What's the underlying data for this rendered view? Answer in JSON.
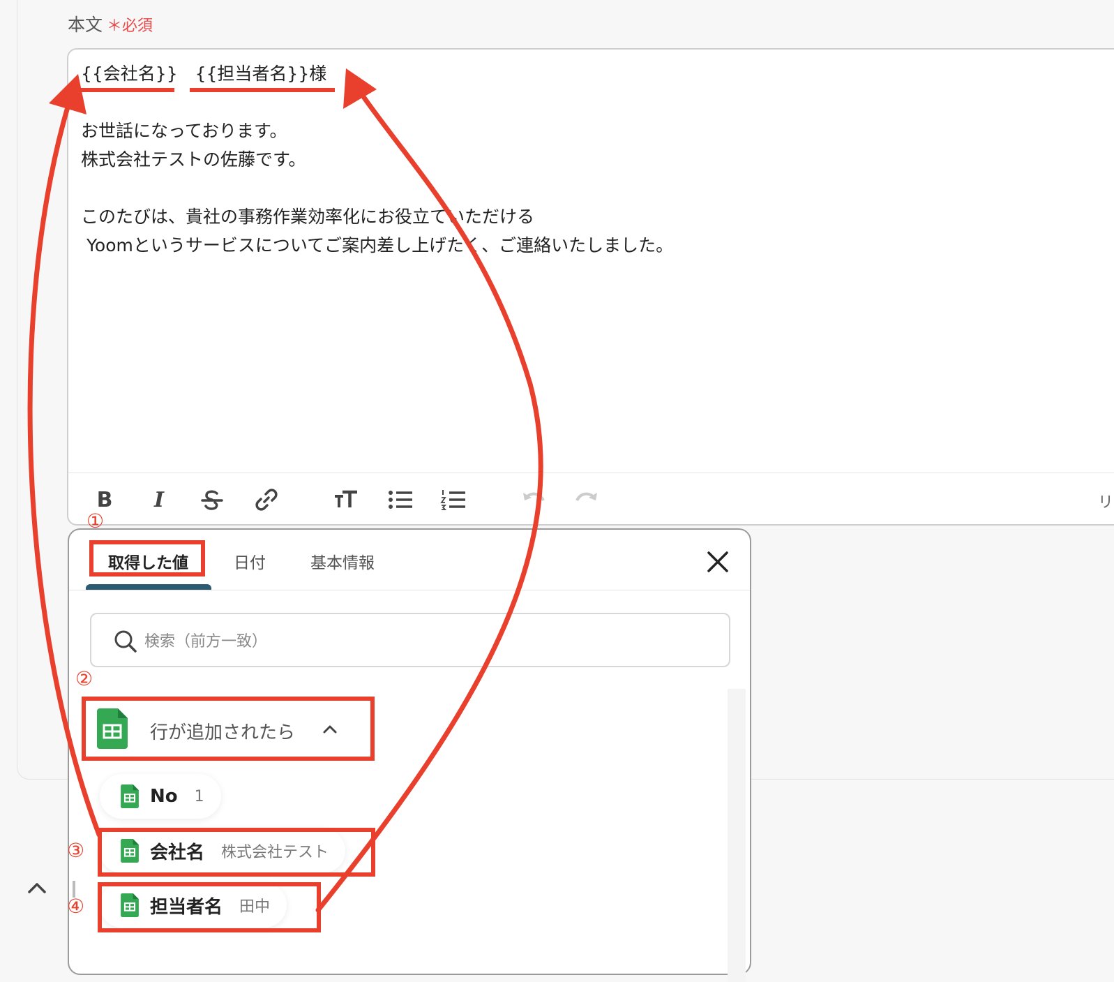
{
  "field": {
    "label": "本文",
    "required_mark": "＊",
    "required_text": "必須"
  },
  "editor": {
    "lines": [
      "{{会社名}}　{{担当者名}}様",
      "",
      "お世話になっております。",
      "株式会社テストの佐藤です。",
      "",
      "このたびは、貴社の事務作業効率化にお役立ていただける",
      " Yoomというサービスについてご案内差し上げたく、ご連絡いたしました。"
    ],
    "toolbar": {
      "bold": "B",
      "italic": "I",
      "right_text": "リッ"
    }
  },
  "popup": {
    "tabs": [
      {
        "label": "取得した値",
        "active": true
      },
      {
        "label": "日付",
        "active": false
      },
      {
        "label": "基本情報",
        "active": false
      }
    ],
    "search_placeholder": "検索（前方一致）",
    "group": {
      "title": "行が追加されたら",
      "icon": "google-sheets-icon",
      "expanded": true
    },
    "items": [
      {
        "name": "No",
        "value": "1"
      },
      {
        "name": "会社名",
        "value": "株式会社テスト"
      },
      {
        "name": "担当者名",
        "value": "田中"
      }
    ]
  },
  "annotations": {
    "step1": "①",
    "step2": "②",
    "step3": "③",
    "step4": "④",
    "color": "#e8402d"
  },
  "colors": {
    "accent_tab": "#2a5b72",
    "sheets_green": "#34a853",
    "required": "#e94a4a"
  }
}
